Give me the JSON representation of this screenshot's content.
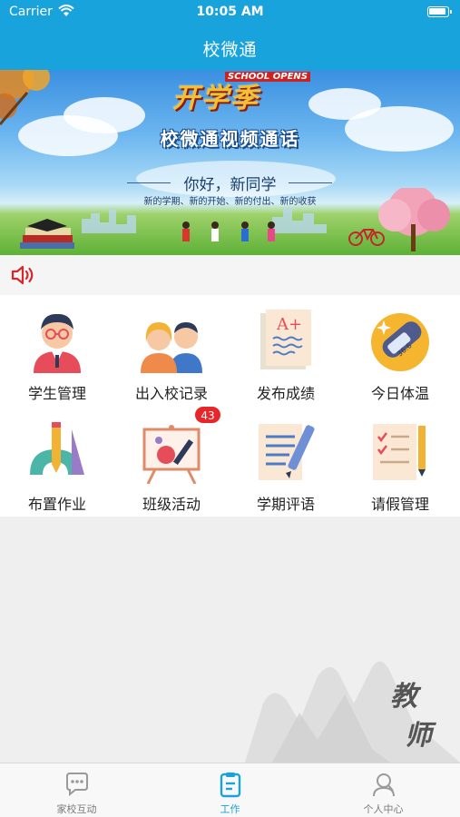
{
  "status_bar": {
    "carrier": "Carrier",
    "time": "10:05 AM"
  },
  "header": {
    "title": "校微通"
  },
  "banner": {
    "logo_en": "SCHOOL OPENS",
    "logo_cn": "开学季",
    "headline": "校微通视频通话",
    "greeting": "你好，新同学",
    "subtitle": "新的学期、新的开始、新的付出、新的收获"
  },
  "grid": {
    "items": [
      {
        "label": "学生管理",
        "icon": "student-icon"
      },
      {
        "label": "出入校记录",
        "icon": "attendance-icon"
      },
      {
        "label": "发布成绩",
        "icon": "grade-paper-icon"
      },
      {
        "label": "今日体温",
        "icon": "thermometer-icon"
      },
      {
        "label": "布置作业",
        "icon": "ruler-pencil-icon"
      },
      {
        "label": "班级活动",
        "icon": "easel-icon",
        "badge": "43"
      },
      {
        "label": "学期评语",
        "icon": "comment-pen-icon"
      },
      {
        "label": "请假管理",
        "icon": "leave-form-icon"
      }
    ]
  },
  "watermark": {
    "text": "教师"
  },
  "tabbar": {
    "tabs": [
      {
        "label": "家校互动",
        "icon": "chat-icon",
        "active": false
      },
      {
        "label": "工作",
        "icon": "clipboard-icon",
        "active": true
      },
      {
        "label": "个人中心",
        "icon": "user-icon",
        "active": false
      }
    ]
  },
  "colors": {
    "primary": "#19a3dd",
    "badge": "#e8262a",
    "speaker": "#d8262a"
  }
}
